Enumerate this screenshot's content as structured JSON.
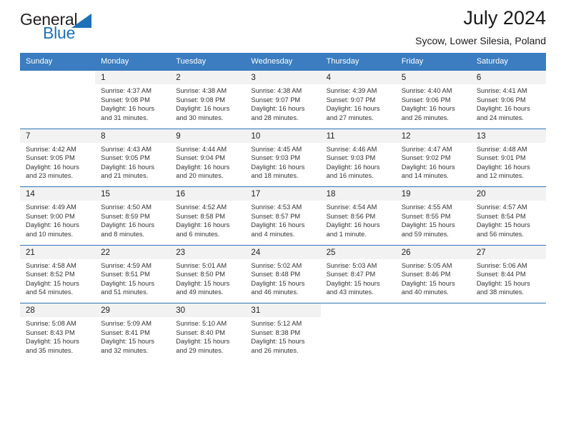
{
  "brand": {
    "word1": "General",
    "word2": "Blue",
    "accent_color": "#1d71b8",
    "triangle_icon": "triangle-icon"
  },
  "header": {
    "title": "July 2024",
    "subtitle": "Sycow, Lower Silesia, Poland"
  },
  "theme": {
    "header_row_bg": "#3b7dc0",
    "row_divider": "#2f72b8",
    "day_number_bg": "#f2f2f2"
  },
  "weekdays": [
    "Sunday",
    "Monday",
    "Tuesday",
    "Wednesday",
    "Thursday",
    "Friday",
    "Saturday"
  ],
  "labels": {
    "sunrise": "Sunrise:",
    "sunset": "Sunset:",
    "daylight": "Daylight:"
  },
  "weeks": [
    {
      "days": [
        {
          "num": "",
          "l1": "",
          "l2": "",
          "l3": "",
          "l4": ""
        },
        {
          "num": "1",
          "l1": "Sunrise: 4:37 AM",
          "l2": "Sunset: 9:08 PM",
          "l3": "Daylight: 16 hours",
          "l4": "and 31 minutes."
        },
        {
          "num": "2",
          "l1": "Sunrise: 4:38 AM",
          "l2": "Sunset: 9:08 PM",
          "l3": "Daylight: 16 hours",
          "l4": "and 30 minutes."
        },
        {
          "num": "3",
          "l1": "Sunrise: 4:38 AM",
          "l2": "Sunset: 9:07 PM",
          "l3": "Daylight: 16 hours",
          "l4": "and 28 minutes."
        },
        {
          "num": "4",
          "l1": "Sunrise: 4:39 AM",
          "l2": "Sunset: 9:07 PM",
          "l3": "Daylight: 16 hours",
          "l4": "and 27 minutes."
        },
        {
          "num": "5",
          "l1": "Sunrise: 4:40 AM",
          "l2": "Sunset: 9:06 PM",
          "l3": "Daylight: 16 hours",
          "l4": "and 26 minutes."
        },
        {
          "num": "6",
          "l1": "Sunrise: 4:41 AM",
          "l2": "Sunset: 9:06 PM",
          "l3": "Daylight: 16 hours",
          "l4": "and 24 minutes."
        }
      ]
    },
    {
      "days": [
        {
          "num": "7",
          "l1": "Sunrise: 4:42 AM",
          "l2": "Sunset: 9:05 PM",
          "l3": "Daylight: 16 hours",
          "l4": "and 23 minutes."
        },
        {
          "num": "8",
          "l1": "Sunrise: 4:43 AM",
          "l2": "Sunset: 9:05 PM",
          "l3": "Daylight: 16 hours",
          "l4": "and 21 minutes."
        },
        {
          "num": "9",
          "l1": "Sunrise: 4:44 AM",
          "l2": "Sunset: 9:04 PM",
          "l3": "Daylight: 16 hours",
          "l4": "and 20 minutes."
        },
        {
          "num": "10",
          "l1": "Sunrise: 4:45 AM",
          "l2": "Sunset: 9:03 PM",
          "l3": "Daylight: 16 hours",
          "l4": "and 18 minutes."
        },
        {
          "num": "11",
          "l1": "Sunrise: 4:46 AM",
          "l2": "Sunset: 9:03 PM",
          "l3": "Daylight: 16 hours",
          "l4": "and 16 minutes."
        },
        {
          "num": "12",
          "l1": "Sunrise: 4:47 AM",
          "l2": "Sunset: 9:02 PM",
          "l3": "Daylight: 16 hours",
          "l4": "and 14 minutes."
        },
        {
          "num": "13",
          "l1": "Sunrise: 4:48 AM",
          "l2": "Sunset: 9:01 PM",
          "l3": "Daylight: 16 hours",
          "l4": "and 12 minutes."
        }
      ]
    },
    {
      "days": [
        {
          "num": "14",
          "l1": "Sunrise: 4:49 AM",
          "l2": "Sunset: 9:00 PM",
          "l3": "Daylight: 16 hours",
          "l4": "and 10 minutes."
        },
        {
          "num": "15",
          "l1": "Sunrise: 4:50 AM",
          "l2": "Sunset: 8:59 PM",
          "l3": "Daylight: 16 hours",
          "l4": "and 8 minutes."
        },
        {
          "num": "16",
          "l1": "Sunrise: 4:52 AM",
          "l2": "Sunset: 8:58 PM",
          "l3": "Daylight: 16 hours",
          "l4": "and 6 minutes."
        },
        {
          "num": "17",
          "l1": "Sunrise: 4:53 AM",
          "l2": "Sunset: 8:57 PM",
          "l3": "Daylight: 16 hours",
          "l4": "and 4 minutes."
        },
        {
          "num": "18",
          "l1": "Sunrise: 4:54 AM",
          "l2": "Sunset: 8:56 PM",
          "l3": "Daylight: 16 hours",
          "l4": "and 1 minute."
        },
        {
          "num": "19",
          "l1": "Sunrise: 4:55 AM",
          "l2": "Sunset: 8:55 PM",
          "l3": "Daylight: 15 hours",
          "l4": "and 59 minutes."
        },
        {
          "num": "20",
          "l1": "Sunrise: 4:57 AM",
          "l2": "Sunset: 8:54 PM",
          "l3": "Daylight: 15 hours",
          "l4": "and 56 minutes."
        }
      ]
    },
    {
      "days": [
        {
          "num": "21",
          "l1": "Sunrise: 4:58 AM",
          "l2": "Sunset: 8:52 PM",
          "l3": "Daylight: 15 hours",
          "l4": "and 54 minutes."
        },
        {
          "num": "22",
          "l1": "Sunrise: 4:59 AM",
          "l2": "Sunset: 8:51 PM",
          "l3": "Daylight: 15 hours",
          "l4": "and 51 minutes."
        },
        {
          "num": "23",
          "l1": "Sunrise: 5:01 AM",
          "l2": "Sunset: 8:50 PM",
          "l3": "Daylight: 15 hours",
          "l4": "and 49 minutes."
        },
        {
          "num": "24",
          "l1": "Sunrise: 5:02 AM",
          "l2": "Sunset: 8:48 PM",
          "l3": "Daylight: 15 hours",
          "l4": "and 46 minutes."
        },
        {
          "num": "25",
          "l1": "Sunrise: 5:03 AM",
          "l2": "Sunset: 8:47 PM",
          "l3": "Daylight: 15 hours",
          "l4": "and 43 minutes."
        },
        {
          "num": "26",
          "l1": "Sunrise: 5:05 AM",
          "l2": "Sunset: 8:46 PM",
          "l3": "Daylight: 15 hours",
          "l4": "and 40 minutes."
        },
        {
          "num": "27",
          "l1": "Sunrise: 5:06 AM",
          "l2": "Sunset: 8:44 PM",
          "l3": "Daylight: 15 hours",
          "l4": "and 38 minutes."
        }
      ]
    },
    {
      "days": [
        {
          "num": "28",
          "l1": "Sunrise: 5:08 AM",
          "l2": "Sunset: 8:43 PM",
          "l3": "Daylight: 15 hours",
          "l4": "and 35 minutes."
        },
        {
          "num": "29",
          "l1": "Sunrise: 5:09 AM",
          "l2": "Sunset: 8:41 PM",
          "l3": "Daylight: 15 hours",
          "l4": "and 32 minutes."
        },
        {
          "num": "30",
          "l1": "Sunrise: 5:10 AM",
          "l2": "Sunset: 8:40 PM",
          "l3": "Daylight: 15 hours",
          "l4": "and 29 minutes."
        },
        {
          "num": "31",
          "l1": "Sunrise: 5:12 AM",
          "l2": "Sunset: 8:38 PM",
          "l3": "Daylight: 15 hours",
          "l4": "and 26 minutes."
        },
        {
          "num": "",
          "l1": "",
          "l2": "",
          "l3": "",
          "l4": ""
        },
        {
          "num": "",
          "l1": "",
          "l2": "",
          "l3": "",
          "l4": ""
        },
        {
          "num": "",
          "l1": "",
          "l2": "",
          "l3": "",
          "l4": ""
        }
      ]
    }
  ]
}
